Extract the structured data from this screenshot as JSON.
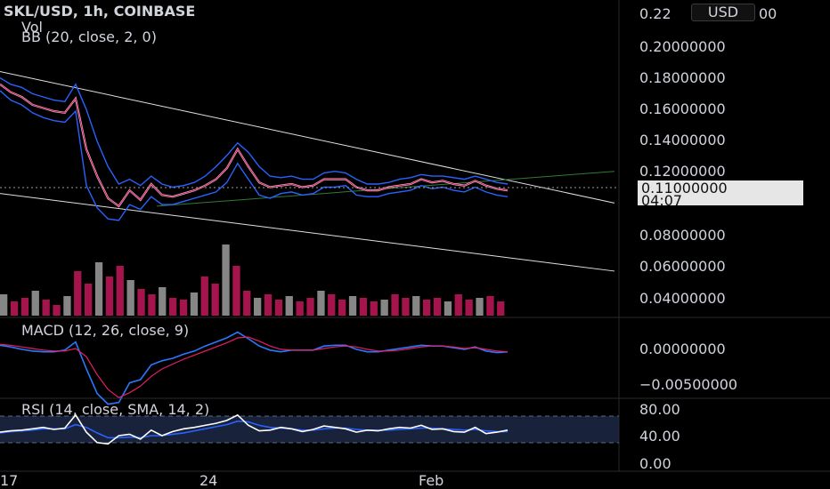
{
  "legend": {
    "symbol_line": "SKL/USD, 1h, COINBASE",
    "vol_label": "Vol",
    "bb_label": "BB (20, close, 2, 0)",
    "macd_label": "MACD (12, 26, close, 9)",
    "rsi_label": "RSI (14, close, SMA, 14, 2)"
  },
  "currency_badge": "USD",
  "last_price": {
    "value": "0.11000000",
    "countdown": "04:07"
  },
  "colors": {
    "background": "#000000",
    "candle": "#c2185b",
    "band": "#2962ff",
    "volume_up": "#9e9e9e",
    "volume_down": "#c2185b",
    "macd": "#2979ff",
    "signal": "#e91e63",
    "rsi": "#ffffff",
    "rsi_ma": "#2962ff",
    "trendline": "#e0e0e0"
  },
  "chart_data": [
    {
      "type": "line",
      "pane": "price",
      "ylim": [
        0.03,
        0.225
      ],
      "y_ticks": [
        "0.20000000",
        "0.18000000",
        "0.16000000",
        "0.14000000",
        "0.12000000",
        "0.08000000",
        "0.06000000",
        "0.04000000"
      ],
      "partial_top_tick": "0.22",
      "x_tick_labels": [
        "17",
        "24",
        "Feb"
      ],
      "series": [
        {
          "values": [
            0.176,
            0.171,
            0.168,
            0.163,
            0.161,
            0.159,
            0.158,
            0.167,
            0.135,
            0.118,
            0.104,
            0.099,
            0.109,
            0.103,
            0.113,
            0.106,
            0.105,
            0.107,
            0.109,
            0.112,
            0.116,
            0.123,
            0.135,
            0.124,
            0.114,
            0.111,
            0.112,
            0.113,
            0.111,
            0.112,
            0.116,
            0.116,
            0.116,
            0.111,
            0.109,
            0.109,
            0.111,
            0.112,
            0.113,
            0.116,
            0.114,
            0.115,
            0.113,
            0.112,
            0.115,
            0.112,
            0.11,
            0.109
          ]
        },
        {
          "values": [
            0.18,
            0.176,
            0.174,
            0.17,
            0.168,
            0.166,
            0.165,
            0.176,
            0.16,
            0.14,
            0.124,
            0.113,
            0.116,
            0.112,
            0.118,
            0.113,
            0.111,
            0.112,
            0.114,
            0.118,
            0.124,
            0.131,
            0.139,
            0.133,
            0.124,
            0.118,
            0.117,
            0.118,
            0.116,
            0.116,
            0.12,
            0.121,
            0.12,
            0.116,
            0.113,
            0.113,
            0.114,
            0.116,
            0.117,
            0.119,
            0.118,
            0.118,
            0.117,
            0.116,
            0.118,
            0.116,
            0.114,
            0.113
          ]
        },
        {
          "values": [
            0.172,
            0.166,
            0.163,
            0.158,
            0.155,
            0.153,
            0.152,
            0.159,
            0.112,
            0.098,
            0.091,
            0.09,
            0.1,
            0.097,
            0.105,
            0.1,
            0.1,
            0.102,
            0.104,
            0.106,
            0.108,
            0.114,
            0.126,
            0.116,
            0.106,
            0.104,
            0.107,
            0.108,
            0.106,
            0.107,
            0.111,
            0.111,
            0.112,
            0.106,
            0.105,
            0.105,
            0.107,
            0.108,
            0.109,
            0.112,
            0.11,
            0.111,
            0.109,
            0.108,
            0.111,
            0.108,
            0.106,
            0.105
          ]
        }
      ],
      "volume": [
        12,
        8,
        10,
        14,
        9,
        6,
        11,
        25,
        18,
        30,
        22,
        28,
        20,
        15,
        12,
        16,
        10,
        9,
        13,
        22,
        18,
        40,
        28,
        14,
        10,
        12,
        9,
        11,
        8,
        10,
        14,
        12,
        9,
        11,
        10,
        8,
        9,
        12,
        10,
        11,
        9,
        10,
        8,
        12,
        9,
        10,
        11,
        8
      ],
      "trendlines": [
        {
          "from": [
            0,
            0.184
          ],
          "to": [
            1,
            0.101
          ]
        },
        {
          "from": [
            0,
            0.107
          ],
          "to": [
            1,
            0.058
          ]
        },
        {
          "from": [
            0.255,
            0.099
          ],
          "to": [
            1,
            0.121
          ]
        }
      ]
    },
    {
      "type": "line",
      "pane": "macd",
      "y_ticks": [
        "0.00000000",
        "−0.00500000"
      ],
      "ylim": [
        -0.0075,
        0.0035
      ],
      "series": [
        {
          "values": [
            0.0004,
            0.0002,
            -0.0001,
            -0.0003,
            -0.0004,
            -0.0004,
            -0.0002,
            0.0008,
            -0.0025,
            -0.0055,
            -0.0068,
            -0.0066,
            -0.0042,
            -0.0038,
            -0.002,
            -0.0015,
            -0.0012,
            -0.0007,
            -0.0003,
            0.0003,
            0.0008,
            0.0013,
            0.002,
            0.0012,
            0.0003,
            -0.0002,
            -0.0004,
            -0.0002,
            -0.0002,
            -0.0002,
            0.0003,
            0.0004,
            0.0004,
            -0.0001,
            -0.0004,
            -0.0004,
            -0.0002,
            0.0,
            0.0002,
            0.0004,
            0.0003,
            0.0003,
            0.0001,
            -0.0001,
            0.0002,
            -0.0003,
            -0.0005,
            -0.0004
          ]
        },
        {
          "values": [
            0.0005,
            0.0004,
            0.0002,
            0.0,
            -0.0002,
            -0.0003,
            -0.0003,
            0.0,
            -0.001,
            -0.0032,
            -0.005,
            -0.006,
            -0.0054,
            -0.0046,
            -0.0034,
            -0.0025,
            -0.0019,
            -0.0013,
            -0.0008,
            -0.0003,
            0.0002,
            0.0007,
            0.0013,
            0.0014,
            0.0009,
            0.0003,
            -0.0001,
            -0.0002,
            -0.0002,
            -0.0002,
            0.0,
            0.0002,
            0.0003,
            0.0002,
            -0.0001,
            -0.0003,
            -0.0003,
            -0.0002,
            0.0,
            0.0002,
            0.0003,
            0.0003,
            0.0002,
            0.0,
            0.0001,
            -0.0001,
            -0.0003,
            -0.0004
          ]
        }
      ]
    },
    {
      "type": "line",
      "pane": "rsi",
      "y_ticks": [
        "80.00",
        "40.00",
        "0.00"
      ],
      "ylim": [
        0,
        80
      ],
      "band": [
        30,
        70
      ],
      "series": [
        {
          "values": [
            45,
            47,
            48,
            50,
            52,
            49,
            51,
            70,
            45,
            30,
            28,
            40,
            42,
            35,
            48,
            40,
            46,
            50,
            52,
            55,
            58,
            62,
            70,
            55,
            47,
            48,
            52,
            50,
            46,
            49,
            54,
            52,
            50,
            45,
            48,
            47,
            50,
            52,
            51,
            55,
            49,
            50,
            46,
            45,
            52,
            43,
            45,
            48
          ]
        },
        {
          "values": [
            44,
            46,
            47,
            48,
            50,
            50,
            50,
            56,
            52,
            44,
            37,
            37,
            38,
            37,
            40,
            40,
            42,
            44,
            47,
            50,
            53,
            56,
            61,
            60,
            55,
            52,
            51,
            50,
            48,
            48,
            50,
            51,
            51,
            49,
            48,
            48,
            48,
            49,
            50,
            51,
            51,
            50,
            49,
            48,
            49,
            47,
            46,
            46
          ]
        }
      ]
    }
  ]
}
